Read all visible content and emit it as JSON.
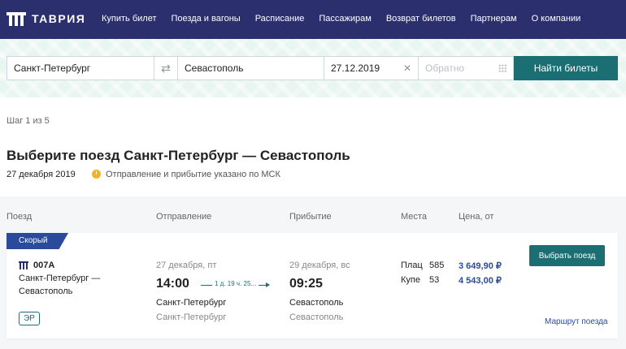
{
  "header": {
    "logo_text": "ТАВРИЯ",
    "nav": [
      "Купить билет",
      "Поезда и вагоны",
      "Расписание",
      "Пассажирам",
      "Возврат билетов",
      "Партнерам",
      "О компании"
    ]
  },
  "search": {
    "from": "Санкт-Петербург",
    "to": "Севастополь",
    "date": "27.12.2019",
    "return_placeholder": "Обратно",
    "submit_label": "Найти билеты"
  },
  "page": {
    "step": "Шаг 1 из 5",
    "title": "Выберите поезд Санкт-Петербург — Севастополь",
    "date": "27 декабря 2019",
    "tz_note": "Отправление и прибытие указано по МСК"
  },
  "columns": {
    "train": "Поезд",
    "departure": "Отправление",
    "arrival": "Прибытие",
    "seats": "Места",
    "price": "Цена, от"
  },
  "train": {
    "category": "Скорый",
    "number": "007А",
    "route": "Санкт-Петербург — Севастополь",
    "badge": "ЭР",
    "departure": {
      "date": "27 декабря, пт",
      "time": "14:00",
      "city": "Санкт-Петербург",
      "station": "Санкт-Петербург"
    },
    "duration": "1 д. 19 ч. 25...",
    "arrival": {
      "date": "29 декабря, вс",
      "time": "09:25",
      "city": "Севастополь",
      "station": "Севастополь"
    },
    "seats": [
      {
        "type": "Плац",
        "count": "585",
        "price": "3 649,90 ₽"
      },
      {
        "type": "Купе",
        "count": "53",
        "price": "4 543,00 ₽"
      }
    ],
    "choose_label": "Выбрать поезд",
    "route_link": "Маршрут поезда"
  },
  "colors": {
    "header_bg": "#2b2f6e",
    "accent": "#1b6f73",
    "price": "#2b4a9b",
    "ribbon": "#2b4a9b",
    "tz_icon": "#f5b324"
  },
  "icons": {
    "swap": "swap-arrows-icon",
    "clear": "close-icon",
    "calendar": "calendar-icon",
    "clock": "clock-icon",
    "train": "train-logo-icon"
  }
}
